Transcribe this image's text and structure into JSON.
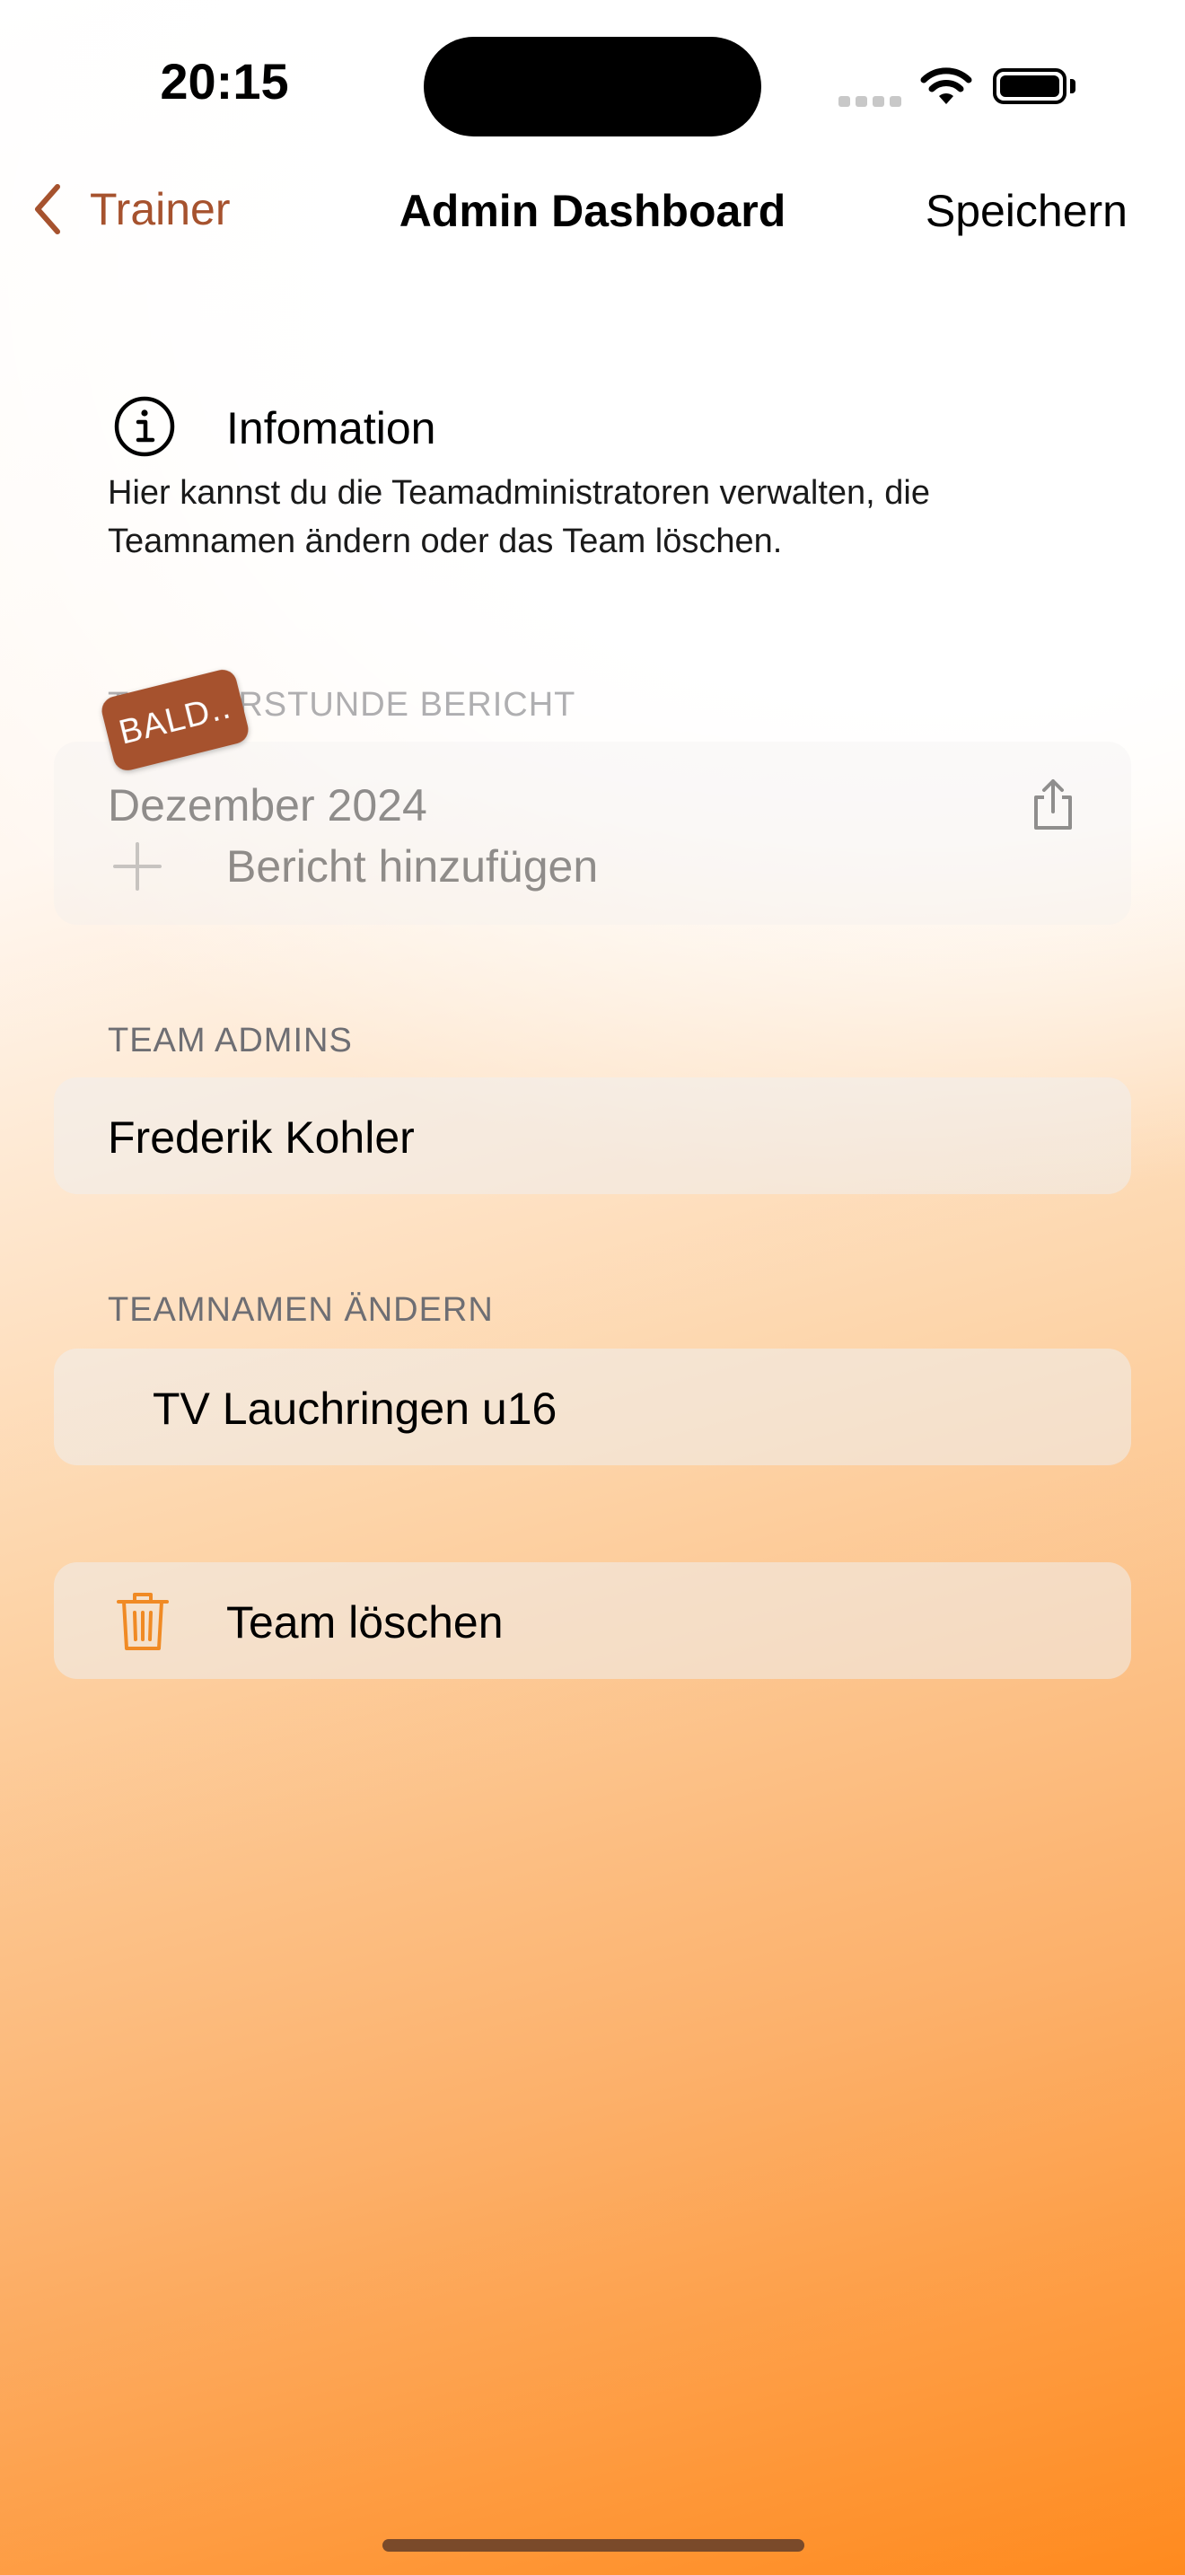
{
  "status_bar": {
    "time": "20:15"
  },
  "nav": {
    "back_label": "Trainer",
    "title": "Admin Dashboard",
    "save_label": "Speichern"
  },
  "info": {
    "title": "Infomation",
    "text": "Hier kannst du die Teamadministratoren verwalten, die Teamnamen ändern oder das Team löschen."
  },
  "report_section": {
    "header": "TRAINERSTUNDE BERICHT",
    "badge": "BALD..",
    "month": "Dezember 2024",
    "add_label": "Bericht hinzufügen"
  },
  "admins_section": {
    "header": "TEAM ADMINS",
    "admins": [
      "Frederik Kohler"
    ]
  },
  "teamname_section": {
    "header": "TEAMNAMEN ÄNDERN",
    "value": "TV Lauchringen u16"
  },
  "delete": {
    "label": "Team löschen"
  },
  "colors": {
    "accent": "#a6522e",
    "delete_icon": "#f08a24",
    "gradient_bottom": "#ff8a1e"
  },
  "icons": {
    "back": "chevron-left-icon",
    "info": "info-circle-icon",
    "share": "share-icon",
    "add": "plus-icon",
    "delete": "trash-icon"
  }
}
